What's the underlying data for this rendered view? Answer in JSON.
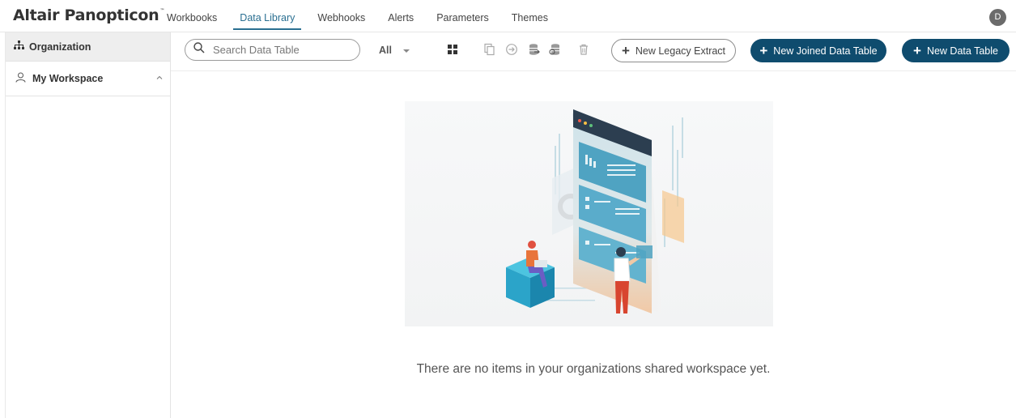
{
  "app": {
    "brand": "Altair Panopticon",
    "brand_tm": "™",
    "user_initial": "D"
  },
  "nav": {
    "items": [
      {
        "label": "Workbooks",
        "active": false
      },
      {
        "label": "Data Library",
        "active": true
      },
      {
        "label": "Webhooks",
        "active": false
      },
      {
        "label": "Alerts",
        "active": false
      },
      {
        "label": "Parameters",
        "active": false
      },
      {
        "label": "Themes",
        "active": false
      }
    ]
  },
  "sidebar": {
    "organization_label": "Organization",
    "workspace_label": "My Workspace"
  },
  "toolbar": {
    "search_placeholder": "Search Data Table",
    "filter_value": "All",
    "legacy_extract_label": "New Legacy Extract",
    "joined_table_label": "New Joined Data Table",
    "new_table_label": "New Data Table",
    "icons": [
      "grid-view-icon",
      "copy-icon",
      "move-icon",
      "database-export-icon",
      "database-refresh-icon",
      "delete-icon"
    ]
  },
  "main": {
    "empty_message": "There are no items in your organizations shared workspace yet."
  },
  "colors": {
    "accent": "#2a6f91",
    "button_fill": "#0f4c6e",
    "sidebar_active_bg": "#eeeeee"
  }
}
